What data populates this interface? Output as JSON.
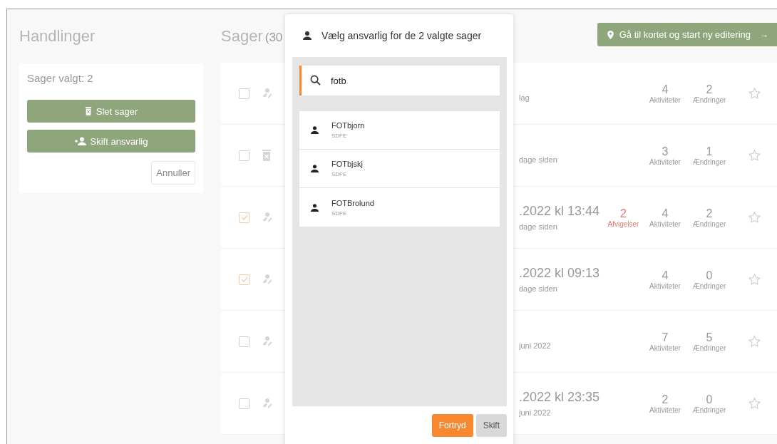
{
  "left_panel": {
    "title": "Handlinger",
    "card": {
      "selected_count": "Sager valgt: 2",
      "buttons": [
        {
          "kind": "delete",
          "label": "Slet sager"
        },
        {
          "kind": "assign",
          "label": "Skift ansvarlig"
        }
      ],
      "cancel": "Annuller"
    }
  },
  "main": {
    "title": "Sager",
    "count": "(30",
    "map_button": {
      "label": "Gå til kortet og start ny editering",
      "arrow": "→"
    },
    "rows": [
      {
        "checked": false,
        "kind": "person",
        "subtitle": "lag",
        "activities": {
          "count": "4",
          "label": "Aktiviteter"
        },
        "changes": {
          "count": "2",
          "label": "Ændringer"
        },
        "starred": false
      },
      {
        "checked": false,
        "kind": "trash",
        "subtitle": "dage siden",
        "activities": {
          "count": "3",
          "label": "Aktiviteter"
        },
        "changes": {
          "count": "1",
          "label": "Ændringer"
        },
        "starred": false
      },
      {
        "checked": true,
        "kind": "person",
        "title": ".2022 kl 13:44",
        "subtitle": "dage siden",
        "deviations": {
          "count": "2",
          "label": "Afvigelser"
        },
        "activities": {
          "count": "4",
          "label": "Aktiviteter"
        },
        "changes": {
          "count": "2",
          "label": "Ændringer"
        },
        "starred": false
      },
      {
        "checked": true,
        "kind": "person",
        "title": ".2022 kl 09:13",
        "subtitle": "dage siden",
        "activities": {
          "count": "4",
          "label": "Aktiviteter"
        },
        "changes": {
          "count": "0",
          "label": "Ændringer"
        },
        "starred": false
      },
      {
        "checked": false,
        "kind": "person",
        "subtitle": "juni 2022",
        "activities": {
          "count": "7",
          "label": "Aktiviteter"
        },
        "changes": {
          "count": "5",
          "label": "Ændringer"
        },
        "starred": false
      },
      {
        "checked": false,
        "kind": "person",
        "title": ".2022 kl 23:35",
        "subtitle": "juni 2022",
        "activities": {
          "count": "2",
          "label": "Aktiviteter"
        },
        "changes": {
          "count": "0",
          "label": "Ændringer"
        },
        "starred": false
      }
    ]
  },
  "modal": {
    "title": "Vælg ansvarlig for de 2 valgte sager",
    "search": {
      "value": "fotb"
    },
    "results": [
      {
        "name": "FOTbjorn",
        "org": "SDFE"
      },
      {
        "name": "FOTbjskj",
        "org": "SDFE"
      },
      {
        "name": "FOTBrolund",
        "org": "SDFE"
      }
    ],
    "buttons": [
      {
        "kind": "primary",
        "label": "Fortryd"
      },
      {
        "kind": "secondary",
        "label": "Skift"
      }
    ]
  }
}
